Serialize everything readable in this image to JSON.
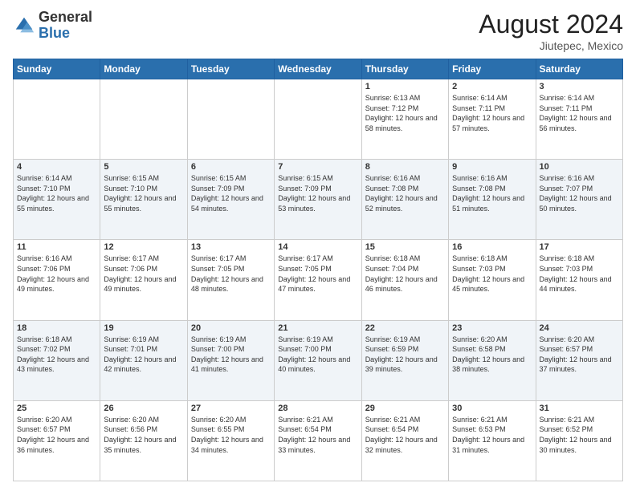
{
  "header": {
    "logo_general": "General",
    "logo_blue": "Blue",
    "month_title": "August 2024",
    "location": "Jiutepec, Mexico"
  },
  "days_of_week": [
    "Sunday",
    "Monday",
    "Tuesday",
    "Wednesday",
    "Thursday",
    "Friday",
    "Saturday"
  ],
  "weeks": [
    [
      {
        "day": "",
        "sunrise": "",
        "sunset": "",
        "daylight": ""
      },
      {
        "day": "",
        "sunrise": "",
        "sunset": "",
        "daylight": ""
      },
      {
        "day": "",
        "sunrise": "",
        "sunset": "",
        "daylight": ""
      },
      {
        "day": "",
        "sunrise": "",
        "sunset": "",
        "daylight": ""
      },
      {
        "day": "1",
        "sunrise": "Sunrise: 6:13 AM",
        "sunset": "Sunset: 7:12 PM",
        "daylight": "Daylight: 12 hours and 58 minutes."
      },
      {
        "day": "2",
        "sunrise": "Sunrise: 6:14 AM",
        "sunset": "Sunset: 7:11 PM",
        "daylight": "Daylight: 12 hours and 57 minutes."
      },
      {
        "day": "3",
        "sunrise": "Sunrise: 6:14 AM",
        "sunset": "Sunset: 7:11 PM",
        "daylight": "Daylight: 12 hours and 56 minutes."
      }
    ],
    [
      {
        "day": "4",
        "sunrise": "Sunrise: 6:14 AM",
        "sunset": "Sunset: 7:10 PM",
        "daylight": "Daylight: 12 hours and 55 minutes."
      },
      {
        "day": "5",
        "sunrise": "Sunrise: 6:15 AM",
        "sunset": "Sunset: 7:10 PM",
        "daylight": "Daylight: 12 hours and 55 minutes."
      },
      {
        "day": "6",
        "sunrise": "Sunrise: 6:15 AM",
        "sunset": "Sunset: 7:09 PM",
        "daylight": "Daylight: 12 hours and 54 minutes."
      },
      {
        "day": "7",
        "sunrise": "Sunrise: 6:15 AM",
        "sunset": "Sunset: 7:09 PM",
        "daylight": "Daylight: 12 hours and 53 minutes."
      },
      {
        "day": "8",
        "sunrise": "Sunrise: 6:16 AM",
        "sunset": "Sunset: 7:08 PM",
        "daylight": "Daylight: 12 hours and 52 minutes."
      },
      {
        "day": "9",
        "sunrise": "Sunrise: 6:16 AM",
        "sunset": "Sunset: 7:08 PM",
        "daylight": "Daylight: 12 hours and 51 minutes."
      },
      {
        "day": "10",
        "sunrise": "Sunrise: 6:16 AM",
        "sunset": "Sunset: 7:07 PM",
        "daylight": "Daylight: 12 hours and 50 minutes."
      }
    ],
    [
      {
        "day": "11",
        "sunrise": "Sunrise: 6:16 AM",
        "sunset": "Sunset: 7:06 PM",
        "daylight": "Daylight: 12 hours and 49 minutes."
      },
      {
        "day": "12",
        "sunrise": "Sunrise: 6:17 AM",
        "sunset": "Sunset: 7:06 PM",
        "daylight": "Daylight: 12 hours and 49 minutes."
      },
      {
        "day": "13",
        "sunrise": "Sunrise: 6:17 AM",
        "sunset": "Sunset: 7:05 PM",
        "daylight": "Daylight: 12 hours and 48 minutes."
      },
      {
        "day": "14",
        "sunrise": "Sunrise: 6:17 AM",
        "sunset": "Sunset: 7:05 PM",
        "daylight": "Daylight: 12 hours and 47 minutes."
      },
      {
        "day": "15",
        "sunrise": "Sunrise: 6:18 AM",
        "sunset": "Sunset: 7:04 PM",
        "daylight": "Daylight: 12 hours and 46 minutes."
      },
      {
        "day": "16",
        "sunrise": "Sunrise: 6:18 AM",
        "sunset": "Sunset: 7:03 PM",
        "daylight": "Daylight: 12 hours and 45 minutes."
      },
      {
        "day": "17",
        "sunrise": "Sunrise: 6:18 AM",
        "sunset": "Sunset: 7:03 PM",
        "daylight": "Daylight: 12 hours and 44 minutes."
      }
    ],
    [
      {
        "day": "18",
        "sunrise": "Sunrise: 6:18 AM",
        "sunset": "Sunset: 7:02 PM",
        "daylight": "Daylight: 12 hours and 43 minutes."
      },
      {
        "day": "19",
        "sunrise": "Sunrise: 6:19 AM",
        "sunset": "Sunset: 7:01 PM",
        "daylight": "Daylight: 12 hours and 42 minutes."
      },
      {
        "day": "20",
        "sunrise": "Sunrise: 6:19 AM",
        "sunset": "Sunset: 7:00 PM",
        "daylight": "Daylight: 12 hours and 41 minutes."
      },
      {
        "day": "21",
        "sunrise": "Sunrise: 6:19 AM",
        "sunset": "Sunset: 7:00 PM",
        "daylight": "Daylight: 12 hours and 40 minutes."
      },
      {
        "day": "22",
        "sunrise": "Sunrise: 6:19 AM",
        "sunset": "Sunset: 6:59 PM",
        "daylight": "Daylight: 12 hours and 39 minutes."
      },
      {
        "day": "23",
        "sunrise": "Sunrise: 6:20 AM",
        "sunset": "Sunset: 6:58 PM",
        "daylight": "Daylight: 12 hours and 38 minutes."
      },
      {
        "day": "24",
        "sunrise": "Sunrise: 6:20 AM",
        "sunset": "Sunset: 6:57 PM",
        "daylight": "Daylight: 12 hours and 37 minutes."
      }
    ],
    [
      {
        "day": "25",
        "sunrise": "Sunrise: 6:20 AM",
        "sunset": "Sunset: 6:57 PM",
        "daylight": "Daylight: 12 hours and 36 minutes."
      },
      {
        "day": "26",
        "sunrise": "Sunrise: 6:20 AM",
        "sunset": "Sunset: 6:56 PM",
        "daylight": "Daylight: 12 hours and 35 minutes."
      },
      {
        "day": "27",
        "sunrise": "Sunrise: 6:20 AM",
        "sunset": "Sunset: 6:55 PM",
        "daylight": "Daylight: 12 hours and 34 minutes."
      },
      {
        "day": "28",
        "sunrise": "Sunrise: 6:21 AM",
        "sunset": "Sunset: 6:54 PM",
        "daylight": "Daylight: 12 hours and 33 minutes."
      },
      {
        "day": "29",
        "sunrise": "Sunrise: 6:21 AM",
        "sunset": "Sunset: 6:54 PM",
        "daylight": "Daylight: 12 hours and 32 minutes."
      },
      {
        "day": "30",
        "sunrise": "Sunrise: 6:21 AM",
        "sunset": "Sunset: 6:53 PM",
        "daylight": "Daylight: 12 hours and 31 minutes."
      },
      {
        "day": "31",
        "sunrise": "Sunrise: 6:21 AM",
        "sunset": "Sunset: 6:52 PM",
        "daylight": "Daylight: 12 hours and 30 minutes."
      }
    ]
  ]
}
